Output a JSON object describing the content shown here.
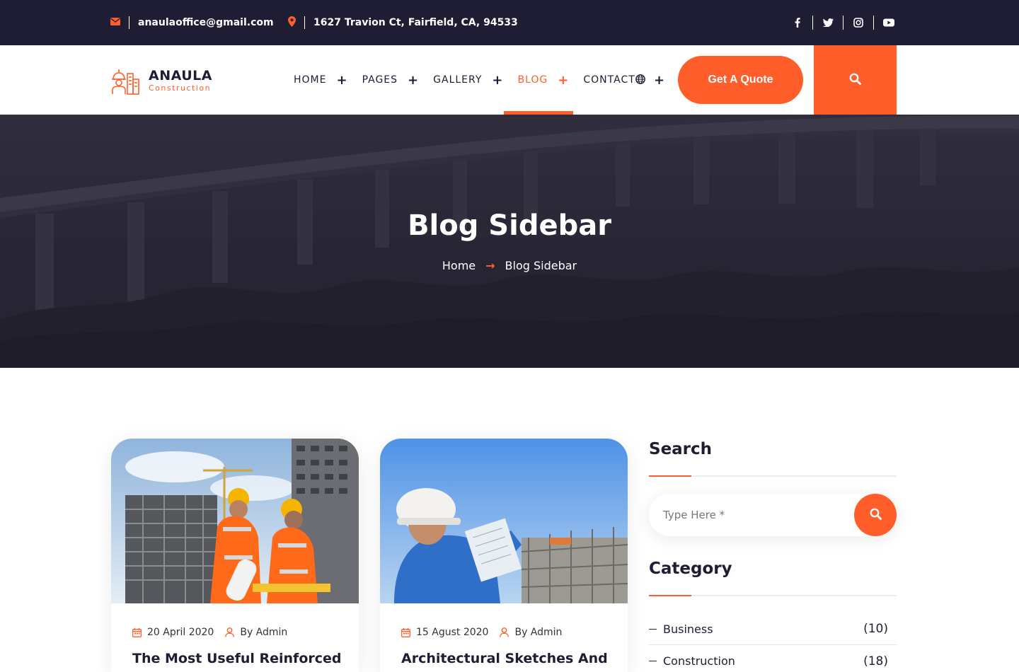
{
  "topbar": {
    "email": "anaulaoffice@gmail.com",
    "address": "1627 Travion Ct, Fairfield, CA, 94533",
    "social": [
      "facebook-icon",
      "twitter-icon",
      "instagram-icon",
      "youtube-icon"
    ]
  },
  "header": {
    "logo_name": "ANAULA",
    "logo_sub": "Construction",
    "nav": [
      {
        "label": "HOME"
      },
      {
        "label": "PAGES"
      },
      {
        "label": "GALLERY"
      },
      {
        "label": "BLOG"
      },
      {
        "label": "CONTACT"
      }
    ],
    "quote_label": "Get A Quote"
  },
  "hero": {
    "title": "Blog Sidebar",
    "breadcrumb_home": "Home",
    "breadcrumb_current": "Blog Sidebar"
  },
  "posts": [
    {
      "date": "20 April 2020",
      "author": "By Admin",
      "title": "The Most Useful Reinforced"
    },
    {
      "date": "15 Agust 2020",
      "author": "By Admin",
      "title": "Architectural Sketches And"
    }
  ],
  "sidebar": {
    "search_heading": "Search",
    "search_placeholder": "Type Here *",
    "category_heading": "Category",
    "categories": [
      {
        "name": "Business",
        "count": "(10)"
      },
      {
        "name": "Construction",
        "count": "(18)"
      }
    ]
  },
  "colors": {
    "accent": "#ff5e2b",
    "dark": "#1f1d33"
  }
}
